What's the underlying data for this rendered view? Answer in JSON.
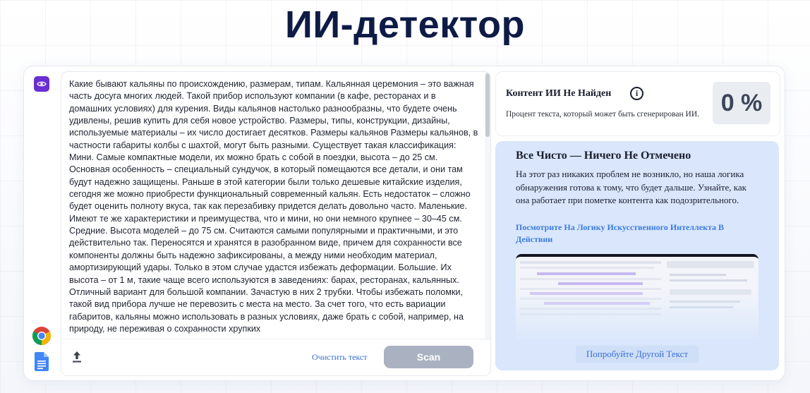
{
  "page": {
    "title": "ИИ-детектор"
  },
  "editor": {
    "text": "Какие бывают кальяны по происхождению, размерам, типам. Кальянная церемония – это важная часть досуга многих людей. Такой прибор используют компании (в кафе, ресторанах и в домашних условиях) для курения. Виды кальянов настолько разнообразны, что будете очень удивлены, решив купить для себя новое устройство. Размеры, типы, конструкции, дизайны, используемые материалы – их число достигает десятков. Размеры кальянов Размеры кальянов, в частности габариты колбы с шахтой, могут быть разными. Существует такая классификация: Мини. Самые компактные модели, их можно брать с собой в поездки, высота – до 25 см. Основная особенность – специальный сундучок, в который помещаются все детали, и они там будут надежно защищены. Раньше в этой категории были только дешевые китайские изделия, сегодня же можно приобрести функциональный современный кальян. Есть недостаток – сложно будет оценить полноту вкуса, так как перезабивку придется делать довольно часто. Маленькие. Имеют те же характеристики и преимущества, что и мини, но они немного крупнее – 30–45 см. Средние. Высота моделей – до 75 см. Считаются самыми популярными и практичными, и это действительно так. Переносятся и хранятся в разобранном виде, причем для сохранности все компоненты должны быть надежно зафиксированы, а между ними необходим материал, амортизирующий удары. Только в этом случае удастся избежать деформации. Большие. Их высота – от 1 м, такие чаще всего используются в заведениях: барах, ресторанах, кальянных. Отличный вариант для большой компании. Зачастую в них 2 трубки. Чтобы избежать поломки, такой вид прибора лучше не перевозить с места на место. За счет того, что есть вариации габаритов, кальяны можно использовать в разных условиях, даже брать с собой, например, на природу, не переживая о сохранности хрупких",
    "clear_label": "Очистить текст",
    "scan_label": "Scan"
  },
  "result": {
    "title": "Контент ИИ Не Найден",
    "info_icon": "i",
    "subtitle": "Процент текста, который может быть сгенерирован ИИ.",
    "percent": "0 %"
  },
  "panel": {
    "title": "Все Чисто — Ничего Не Отмечено",
    "body": "На этот раз никаких проблем не возникло, но наша логика обнаружения готова к тому, что будет дальше. Узнайте, как она работает при пометке контента как подозрительного.",
    "link": "Посмотрите На Логику Искусственного Интеллекта В Действии",
    "try_label": "Попробуйте Другой Текст"
  },
  "icons": {
    "rail": [
      "eye-icon",
      "chrome-icon",
      "google-docs-icon"
    ],
    "upload": "upload-icon"
  },
  "colors": {
    "title": "#0e1b45",
    "accent_purple": "#6a2fd1",
    "link_blue": "#3b6fd6",
    "panel_bg": "#d9e6fb",
    "scan_disabled": "#aab2c2"
  }
}
